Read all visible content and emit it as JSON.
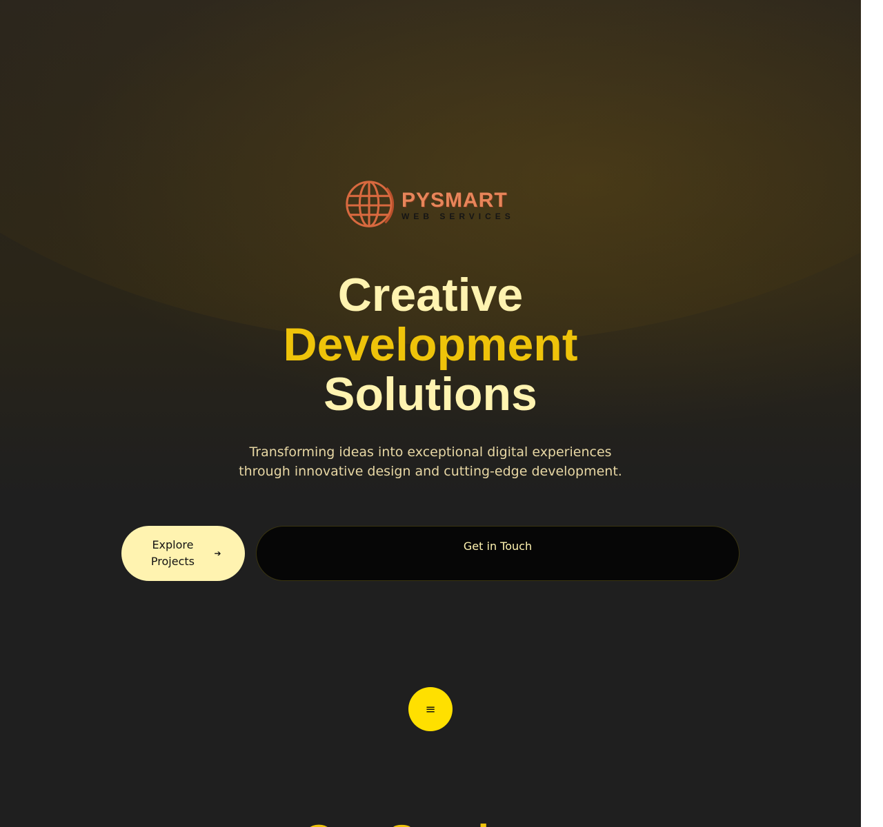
{
  "brand": {
    "name": "PYSMART",
    "tagline": "WEB SERVICES",
    "logo_icon": "globe-icon",
    "logo_color": "#e8855a"
  },
  "hero": {
    "line1": "Creative",
    "line2": "Development",
    "line3": "Solutions",
    "subtitle": "Transforming ideas into exceptional digital experiences through innovative design and cutting-edge development."
  },
  "actions": {
    "explore_label": "Explore Projects",
    "explore_icon": "arrow-right-icon",
    "touch_label": "Get in Touch"
  },
  "menu": {
    "icon": "hamburger-menu-icon",
    "glyph": "≡"
  },
  "next_section": {
    "heading": "Our Services"
  },
  "colors": {
    "accent": "#eec30a",
    "cream": "#fff3b0",
    "fab": "#ffe000",
    "background": "#1f1f1f"
  }
}
